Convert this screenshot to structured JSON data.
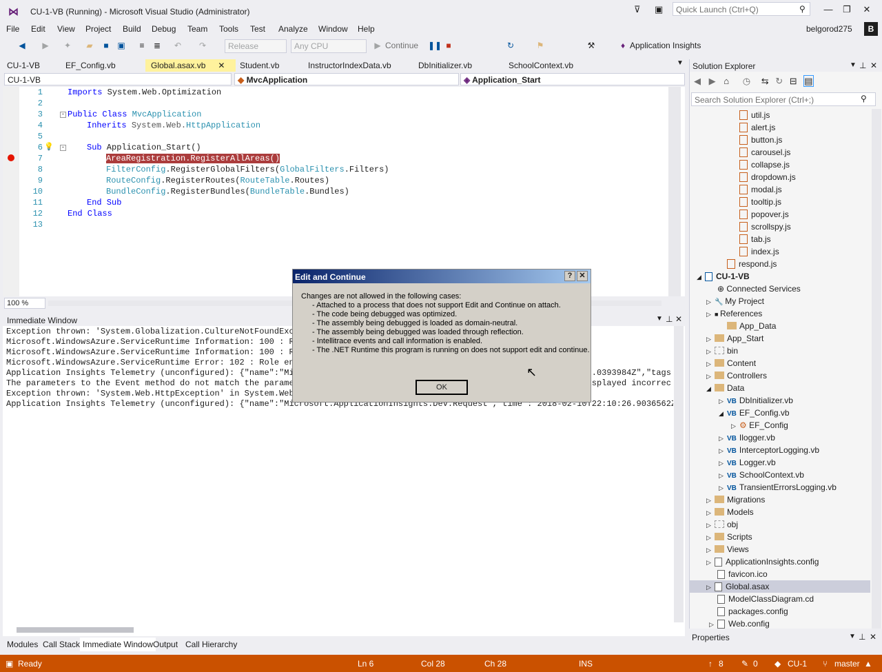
{
  "window": {
    "title": "CU-1-VB (Running) - Microsoft Visual Studio  (Administrator)",
    "quick_launch_placeholder": "Quick Launch (Ctrl+Q)",
    "user": "belgorod275",
    "user_initial": "B"
  },
  "menu": [
    "File",
    "Edit",
    "View",
    "Project",
    "Build",
    "Debug",
    "Team",
    "Tools",
    "Test",
    "Analyze",
    "Window",
    "Help"
  ],
  "toolbar": {
    "config": "Release",
    "platform": "Any CPU",
    "continue_label": "Continue",
    "app_insights": "Application Insights"
  },
  "tabs": [
    "CU-1-VB",
    "EF_Config.vb",
    "Global.asax.vb",
    "Student.vb",
    "InstructorIndexData.vb",
    "DbInitializer.vb",
    "SchoolContext.vb"
  ],
  "nav": {
    "project": "CU-1-VB",
    "class": "MvcApplication",
    "member": "Application_Start"
  },
  "code": {
    "line_numbers": [
      "1",
      "2",
      "3",
      "4",
      "5",
      "6",
      "7",
      "8",
      "9",
      "10",
      "11",
      "12",
      "13"
    ],
    "l1_kw": "Imports",
    "l1_rest": " System.Web.Optimization",
    "l3_kw": "Public Class",
    "l3_type": "MvcApplication",
    "l4_kw": "Inherits",
    "l4_ns": "System.Web.",
    "l4_type": "HttpApplication",
    "l6_kw": "Sub",
    "l6_rest": " Application_Start()",
    "l7": "AreaRegistration.RegisterAllAreas()",
    "l8_type": "FilterConfig",
    "l8_mid": ".RegisterGlobalFilters(",
    "l8_type2": "GlobalFilters",
    "l8_end": ".Filters)",
    "l9_type": "RouteConfig",
    "l9_mid": ".RegisterRoutes(",
    "l9_type2": "RouteTable",
    "l9_end": ".Routes)",
    "l10_type": "BundleConfig",
    "l10_mid": ".RegisterBundles(",
    "l10_type2": "BundleTable",
    "l10_end": ".Bundles)",
    "l11": "End Sub",
    "l12": "End Class"
  },
  "zoom": "100 %",
  "immediate": {
    "title": "Immediate Window",
    "lines": [
      "Exception thrown: 'System.Globalization.CultureNotFoundExce",
      "Microsoft.WindowsAzure.ServiceRuntime Information: 100 : Ro",
      "Microsoft.WindowsAzure.ServiceRuntime Information: 100 : Ro",
      "Microsoft.WindowsAzure.ServiceRuntime Error: 102 : Role env",
      "Application Insights Telemetry (unconfigured): {\"name\":\"Mic                                                          7.0393984Z\",\"tags",
      "The parameters to the Event method do not match the paramet                                                          isplayed incorrec",
      "Exception thrown: 'System.Web.HttpException' in System.Web.",
      "Application Insights Telemetry (unconfigured): {\"name\":\"Microsoft.ApplicationInsights.Dev.Request\",\"time\":\"2018-02-10T22:10:26.9036562Z\",\""
    ]
  },
  "bottom_tabs": [
    "Modules",
    "Call Stack",
    "Immediate Window",
    "Output",
    "Call Hierarchy"
  ],
  "solution_explorer": {
    "title": "Solution Explorer",
    "search_placeholder": "Search Solution Explorer (Ctrl+;)",
    "js_files": [
      "util.js",
      "alert.js",
      "button.js",
      "carousel.js",
      "collapse.js",
      "dropdown.js",
      "modal.js",
      "tooltip.js",
      "popover.js",
      "scrollspy.js",
      "tab.js",
      "index.js"
    ],
    "respond": "respond.js",
    "project": "CU-1-VB",
    "connected": "Connected Services",
    "my_project": "My Project",
    "references": "References",
    "app_data": "App_Data",
    "app_start": "App_Start",
    "bin": "bin",
    "content": "Content",
    "controllers": "Controllers",
    "data": "Data",
    "data_files": [
      "DbInitializer.vb",
      "EF_Config.vb"
    ],
    "ef_config_class": "EF_Config",
    "data_files2": [
      "Ilogger.vb",
      "InterceptorLogging.vb",
      "Logger.vb",
      "SchoolContext.vb",
      "TransientErrorsLogging.vb"
    ],
    "folders2": [
      "Migrations",
      "Models",
      "obj",
      "Scripts",
      "Views"
    ],
    "files": [
      "ApplicationInsights.config",
      "favicon.ico",
      "Global.asax",
      "ModelClassDiagram.cd",
      "packages.config",
      "Web.config"
    ]
  },
  "properties_title": "Properties",
  "status": {
    "ready": "Ready",
    "ln": "Ln 6",
    "col": "Col 28",
    "ch": "Ch 28",
    "ins": "INS",
    "changes": "8",
    "errors": "0",
    "repo": "CU-1",
    "branch": "master"
  },
  "dialog": {
    "title": "Edit and Continue",
    "help": "?",
    "close": "✕",
    "intro": "Changes are not allowed in the following cases:",
    "cases": [
      "- Attached to a process that does not support Edit and Continue on attach.",
      "- The code being debugged was optimized.",
      "- The assembly being debugged is loaded as domain-neutral.",
      "- The assembly being debugged was loaded through reflection.",
      "- Intellitrace events and call information is enabled.",
      "- The .NET Runtime this program is running on does not support edit and continue."
    ],
    "ok": "OK"
  }
}
